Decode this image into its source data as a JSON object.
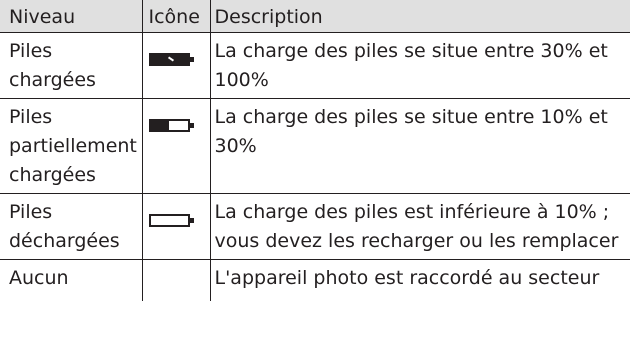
{
  "table": {
    "headers": {
      "level": "Niveau",
      "icon": "Icône",
      "description": "Description"
    },
    "rows": [
      {
        "level_lines": [
          "Piles",
          "chargées"
        ],
        "icon": "battery-full-icon",
        "charge_fraction": 1.0,
        "description": "La charge des piles se situe entre 30% et 100%"
      },
      {
        "level_lines": [
          "Piles",
          "partiellement",
          "chargées"
        ],
        "icon": "battery-partial-icon",
        "charge_fraction": 0.5,
        "description": "La charge des piles se situe entre 10% et 30%"
      },
      {
        "level_lines": [
          "Piles",
          "déchargées"
        ],
        "icon": "battery-empty-icon",
        "charge_fraction": 0.0,
        "description": "La charge des piles est inférieure à 10% ; vous devez les recharger ou les remplacer"
      },
      {
        "level_lines": [
          "Aucun"
        ],
        "icon": "",
        "charge_fraction": null,
        "description": "L'appareil photo est raccordé au secteur"
      }
    ]
  },
  "colors": {
    "text": "#231f20",
    "header_background": "#e0e0e0",
    "rule": "#231f20"
  }
}
